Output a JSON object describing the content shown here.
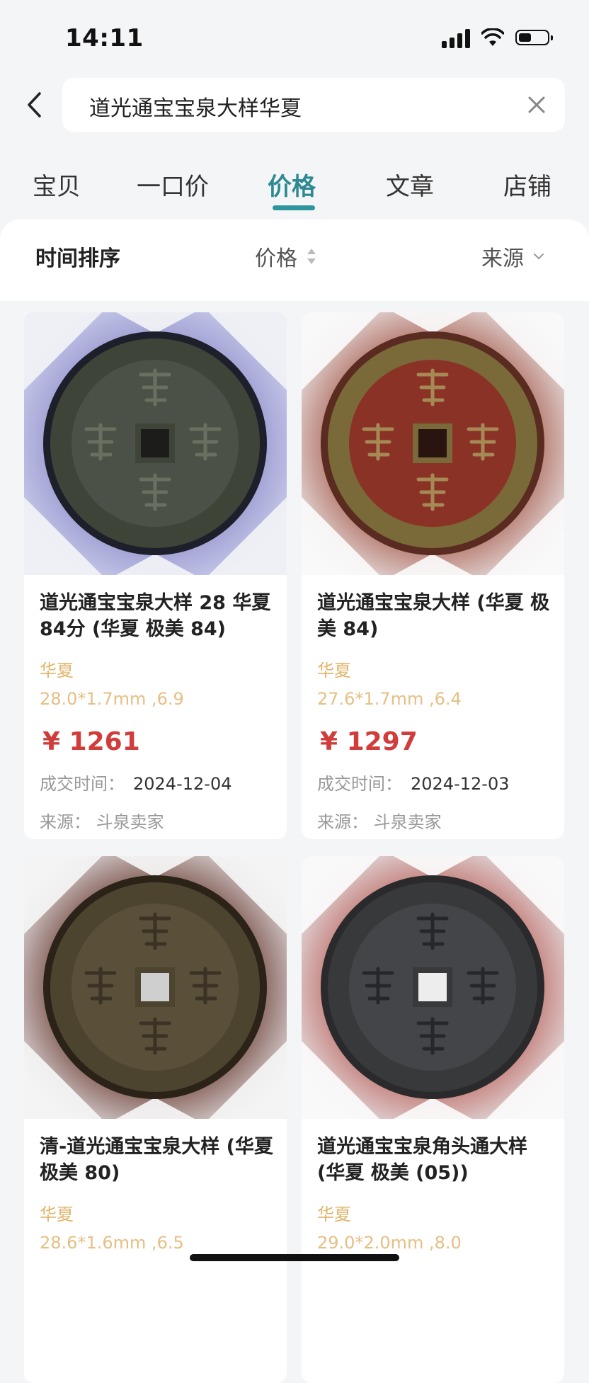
{
  "status_bar": {
    "time": "14:11",
    "battery_percent": 45
  },
  "search": {
    "query": "道光通宝宝泉大样华夏"
  },
  "tabs": [
    {
      "label": "宝贝",
      "active": false
    },
    {
      "label": "一口价",
      "active": false
    },
    {
      "label": "价格",
      "active": true
    },
    {
      "label": "文章",
      "active": false
    },
    {
      "label": "店铺",
      "active": false
    }
  ],
  "sort_bar": {
    "time_sort": "时间排序",
    "price_sort": "价格",
    "source_filter": "来源"
  },
  "colors": {
    "accent": "#2f959c",
    "price": "#d03d3a",
    "grade": "#e0b56b"
  },
  "items": [
    {
      "title": "道光通宝宝泉大样 28 华夏 84分 (华夏 极美 84)",
      "grade_org": "华夏",
      "spec": "28.0*1.7mm ,6.9",
      "price": "¥ 1261",
      "date_label": "成交时间：",
      "date": "2024-12-04",
      "source": "来源：  斗泉卖家",
      "image_icon": "coin-photo"
    },
    {
      "title": "道光通宝宝泉大样 (华夏 极美 84)",
      "grade_org": "华夏",
      "spec": "27.6*1.7mm ,6.4",
      "price": "¥ 1297",
      "date_label": "成交时间：",
      "date": "2024-12-03",
      "source": "来源：  斗泉卖家",
      "image_icon": "coin-photo"
    },
    {
      "title": "清-道光通宝宝泉大样 (华夏 极美 80)",
      "grade_org": "华夏",
      "spec": "28.6*1.6mm ,6.5",
      "price": "",
      "date_label": "",
      "date": "",
      "source": "",
      "image_icon": "coin-photo"
    },
    {
      "title": "道光通宝宝泉角头通大样 (华夏 极美 (05))",
      "grade_org": "华夏",
      "spec": "29.0*2.0mm ,8.0",
      "price": "",
      "date_label": "",
      "date": "",
      "source": "",
      "image_icon": "coin-photo"
    }
  ]
}
